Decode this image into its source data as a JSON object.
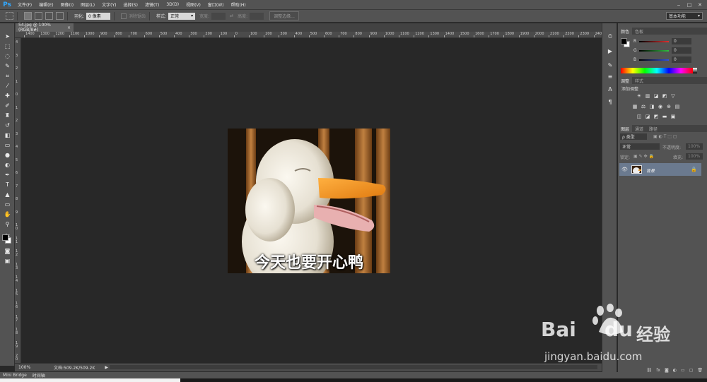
{
  "app": {
    "logo": "Ps"
  },
  "menu": [
    "文件(F)",
    "编辑(E)",
    "图像(I)",
    "图层(L)",
    "文字(Y)",
    "选择(S)",
    "滤镜(T)",
    "3D(D)",
    "视图(V)",
    "窗口(W)",
    "帮助(H)"
  ],
  "window_controls": {
    "minimize": "‒",
    "restore": "□",
    "close": "✕"
  },
  "options": {
    "feather_label": "羽化:",
    "feather_value": "0 像素",
    "antialias_label": "消除锯齿",
    "style_label": "样式:",
    "style_value": "正常",
    "width_label": "宽度:",
    "height_label": "高度:",
    "refine_edge": "调整边缘...",
    "workspace": "基本功能"
  },
  "document": {
    "tab": "54.jpg @ 100%(RGB/8#)",
    "close": "×"
  },
  "ruler": {
    "h": [
      "1400",
      "1300",
      "1200",
      "1100",
      "1000",
      "900",
      "800",
      "700",
      "600",
      "500",
      "400",
      "300",
      "200",
      "100",
      "0",
      "100",
      "200",
      "300",
      "400",
      "500",
      "600",
      "700",
      "800",
      "900",
      "1000",
      "1100",
      "1200",
      "1300",
      "1400",
      "1500",
      "1600",
      "1700",
      "1800",
      "1900",
      "2000",
      "2100",
      "2200",
      "2300",
      "2400"
    ],
    "v": [
      "4",
      "3",
      "2",
      "1",
      "0",
      "1",
      "2",
      "3",
      "4",
      "5",
      "6",
      "7",
      "8",
      "9",
      "1 0",
      "1 1",
      "1 2",
      "1 3",
      "1 4",
      "1 5",
      "1 6",
      "1 7",
      "1 8",
      "1 9",
      "2 0"
    ]
  },
  "image": {
    "caption": "今天也要开心鸭"
  },
  "status": {
    "zoom": "100%",
    "doc_info": "文档:509.2K/509.2K",
    "arrow": "▶"
  },
  "bottom_tabs": [
    "Mini Bridge",
    "时间轴"
  ],
  "color_panel": {
    "tabs": [
      "颜色",
      "色板"
    ],
    "channels": [
      {
        "label": "R",
        "value": "0",
        "color": "#e03030"
      },
      {
        "label": "G",
        "value": "0",
        "color": "#30c040"
      },
      {
        "label": "B",
        "value": "0",
        "color": "#3050e0"
      }
    ]
  },
  "adjust_panel": {
    "tabs": [
      "调整",
      "样式"
    ],
    "title": "添加调整"
  },
  "layers_panel": {
    "tabs": [
      "图层",
      "通道",
      "路径"
    ],
    "kind_label": "ρ 类型",
    "blend_mode": "正常",
    "opacity_label": "不透明度:",
    "opacity_value": "100%",
    "lock_label": "锁定:",
    "fill_label": "填充:",
    "fill_value": "100%",
    "layer_name": "背景"
  },
  "watermark": {
    "bai": "Bai",
    "du": "du",
    "jingyan": "经验",
    "url": "jingyan.baidu.com"
  },
  "colors": {
    "accent": "#31a8ff",
    "panel": "#535353",
    "canvas": "#282828",
    "layer_selected": "#6b7a8f"
  }
}
